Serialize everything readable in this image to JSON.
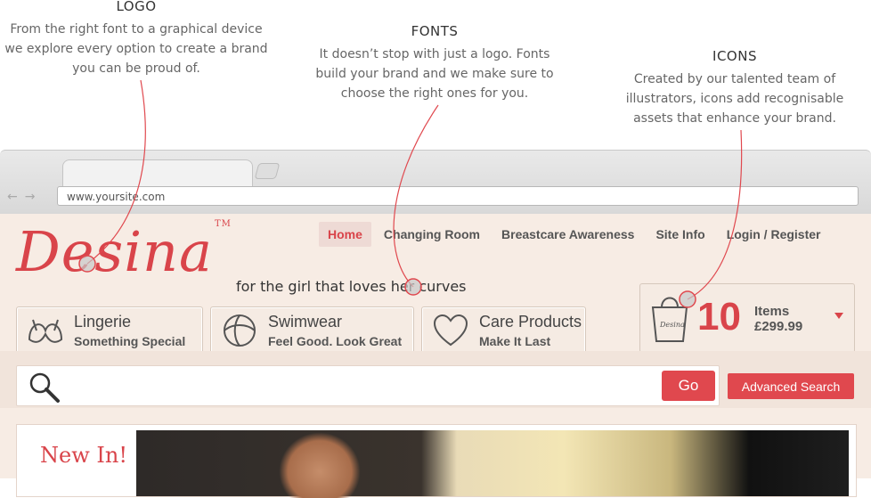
{
  "callouts": {
    "logo": {
      "title": "LOGO",
      "body": "From the right font to a graphical device we explore every option to create a brand you can be proud of."
    },
    "fonts": {
      "title": "FONTS",
      "body": "It doesn’t stop with just a logo. Fonts build your brand and we make sure to choose the right ones for you."
    },
    "icons": {
      "title": "ICONS",
      "body": "Created by our talented team of illustrators, icons add recognisable assets that enhance your brand."
    }
  },
  "browser": {
    "url": "www.yoursite.com",
    "back_icon": "back-arrow-icon",
    "forward_icon": "forward-arrow-icon"
  },
  "site": {
    "logo_text": "Desina",
    "trademark": "TM",
    "tagline": "for the girl that loves her curves",
    "nav": [
      {
        "label": "Home",
        "active": true
      },
      {
        "label": "Changing Room",
        "active": false
      },
      {
        "label": "Breastcare Awareness",
        "active": false
      },
      {
        "label": "Site Info",
        "active": false
      },
      {
        "label": "Login / Register",
        "active": false
      }
    ],
    "categories": [
      {
        "title": "Lingerie",
        "subtitle": "Something Special",
        "icon": "bra-icon"
      },
      {
        "title": "Swimwear",
        "subtitle": "Feel Good. Look Great",
        "icon": "beach-ball-icon"
      },
      {
        "title": "Care Products",
        "subtitle": "Make It Last",
        "icon": "heart-icon"
      }
    ],
    "basket": {
      "count": "10",
      "items_label": "Items",
      "total": "£299.99",
      "bag_label": "Desina"
    },
    "search": {
      "placeholder": "",
      "go_label": "Go",
      "advanced_label": "Advanced Search"
    },
    "new_in_label": "New In!"
  },
  "colors": {
    "brand_red": "#d9444a",
    "site_bg": "#f7ece4"
  }
}
